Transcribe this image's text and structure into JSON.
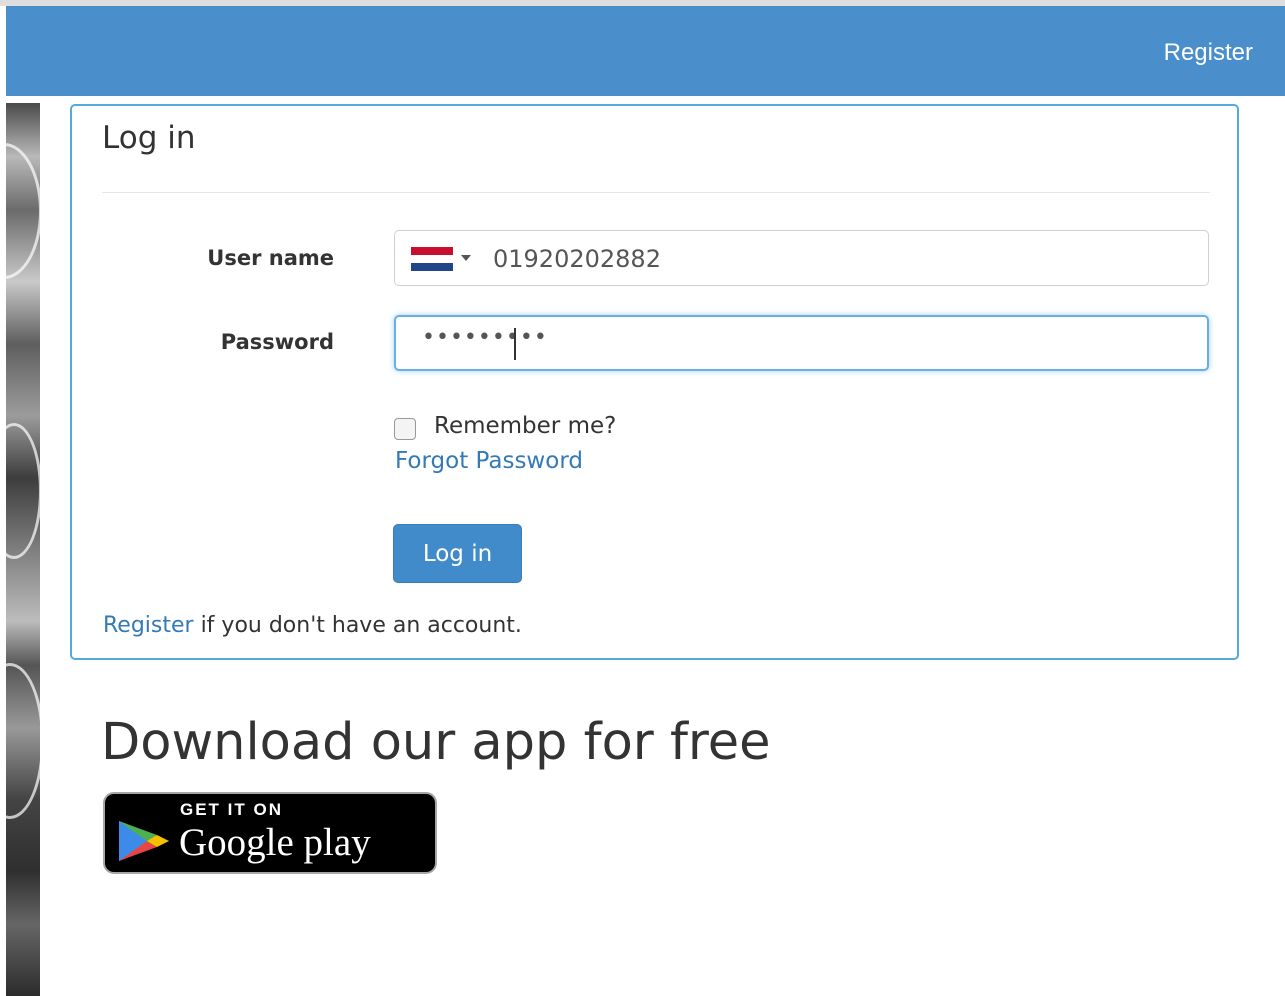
{
  "nav": {
    "register_label": "Register"
  },
  "login": {
    "title": "Log in",
    "username_label": "User name",
    "username_value": "01920202882",
    "password_label": "Password",
    "password_mask": "•••••••••",
    "remember_label": "Remember me?",
    "forgot_label": "Forgot Password",
    "submit_label": "Log in",
    "register_link": "Register",
    "register_suffix": " if you don't have an account."
  },
  "download": {
    "title": "Download our app for free",
    "badge_small": "GET IT ON",
    "badge_big": "Google play"
  },
  "colors": {
    "navbar": "#4a8fcc",
    "link": "#337ab7",
    "button": "#428bca",
    "panel_border": "#55a9dc"
  },
  "icons": [
    "netherlands-flag-icon",
    "caret-down-icon",
    "google-play-icon"
  ]
}
